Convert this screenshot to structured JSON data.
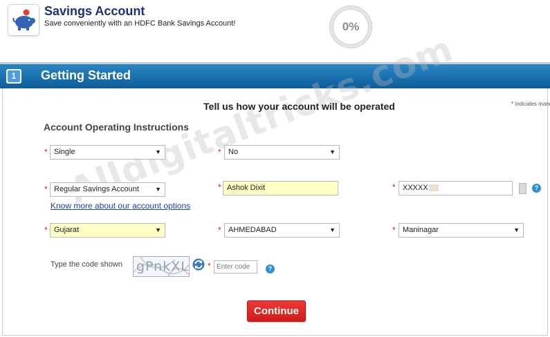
{
  "header": {
    "title": "Savings Account",
    "subtitle": "Save conveniently with an HDFC Bank Savings Account!",
    "progress": "0%"
  },
  "step": {
    "number": "1",
    "title": "Getting Started"
  },
  "form": {
    "heading": "Tell us how your account will be operated",
    "mandatory_note": "indicates mand",
    "required_marker": "*",
    "section_title": "Account Operating Instructions",
    "mode_of_operation": "Single",
    "existing_customer": "No",
    "account_type": "Regular Savings Account",
    "name": "Ashok Dixit",
    "mobile": "XXXXX",
    "account_options_link": "Know more about our account options",
    "state": "Gujarat",
    "city": "AHMEDABAD",
    "branch": "Maninagar",
    "captcha_label": "Type the code shown",
    "captcha_text": "gPnkXL",
    "code_placeholder": "Enter code",
    "help_glyph": "?",
    "dropdown_arrow": "▼",
    "continue_label": "Continue"
  },
  "watermark": "Alldigitaltricks.com",
  "colors": {
    "brand_blue": "#1b2f7a",
    "step_bar": "#1a6fb0",
    "required": "#e02020",
    "continue": "#e02a26",
    "highlight": "#ffffc6",
    "link": "#1a3fb8"
  },
  "icons": {
    "logo": "piggy-bank-icon",
    "refresh": "refresh-icon",
    "help": "help-icon",
    "dropdown": "chevron-down-icon"
  }
}
